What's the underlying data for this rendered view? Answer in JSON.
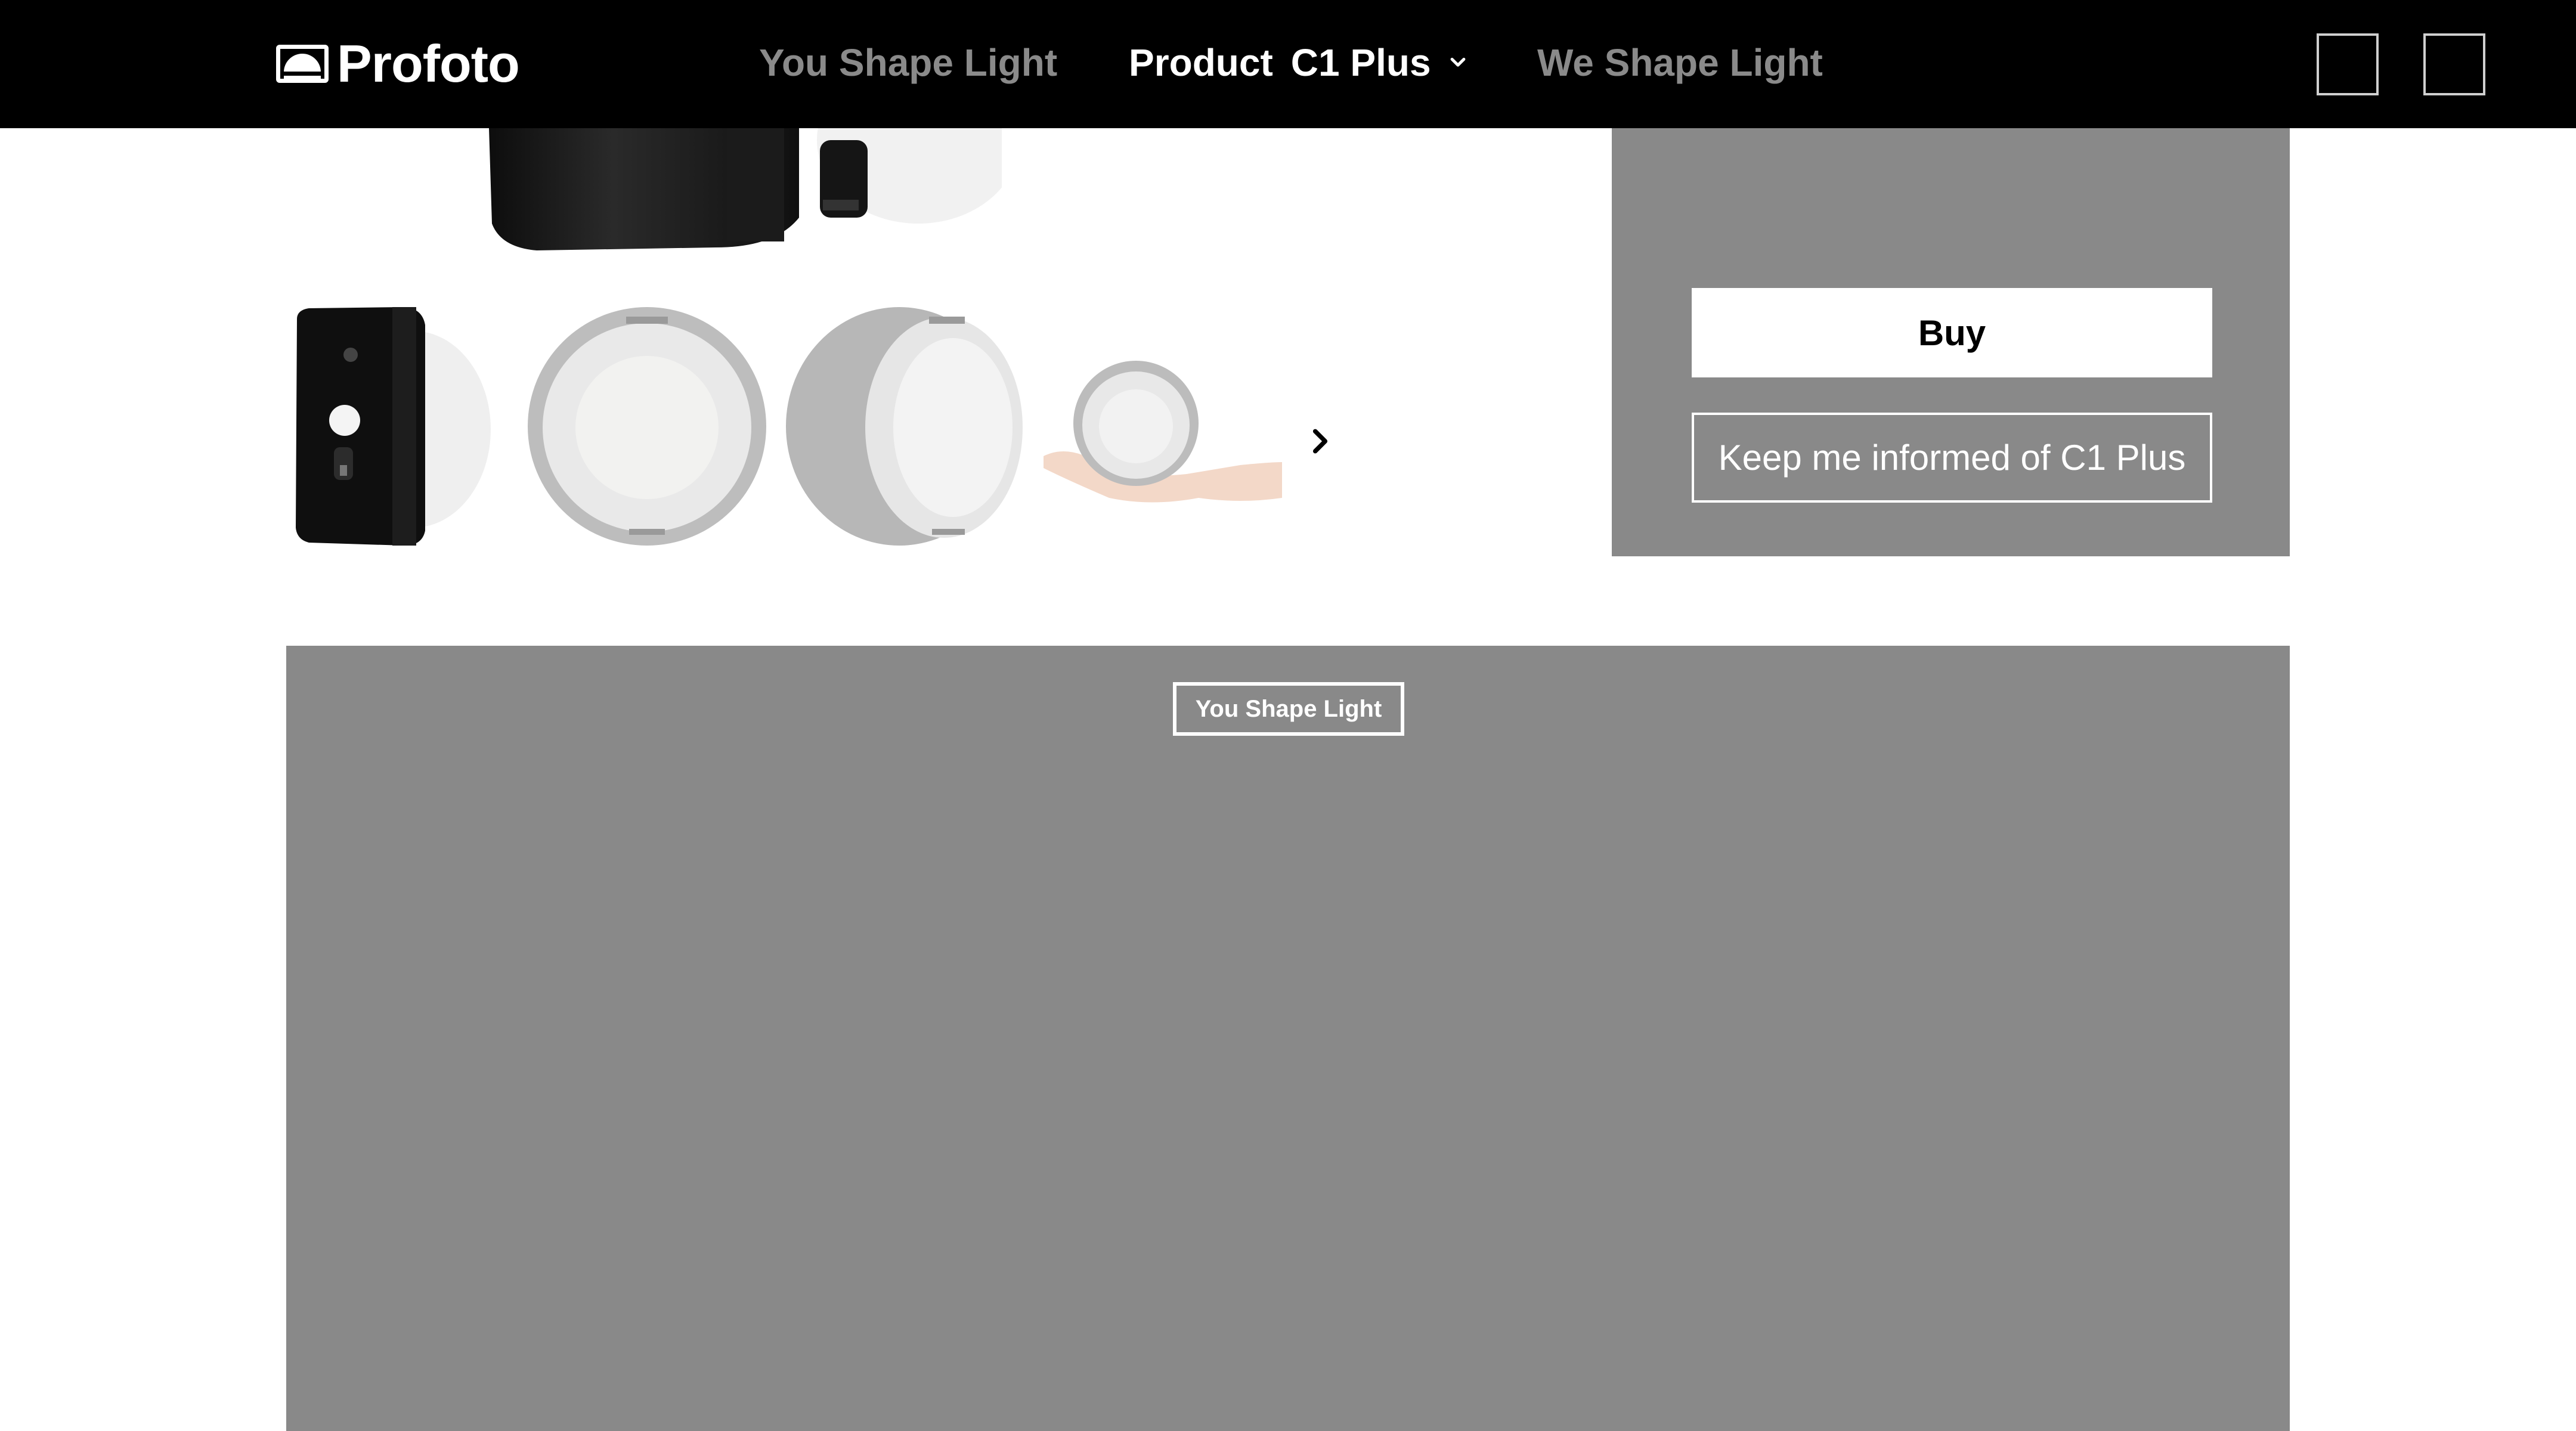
{
  "header": {
    "logo_text": "Profoto",
    "nav": [
      {
        "label": "You Shape Light"
      },
      {
        "label": "Product",
        "sub_label": "C1 Plus"
      },
      {
        "label": "We Shape Light"
      }
    ]
  },
  "gallery": {
    "next_icon": "chevron-right-icon"
  },
  "buy_panel": {
    "buy_label": "Buy",
    "inform_label": "Keep me informed of C1 Plus"
  },
  "promo": {
    "tag_label": "You Shape Light"
  },
  "colors": {
    "header_bg": "#000000",
    "panel_bg": "#898989",
    "nav_inactive": "#8a8a8a",
    "nav_active": "#ffffff"
  }
}
